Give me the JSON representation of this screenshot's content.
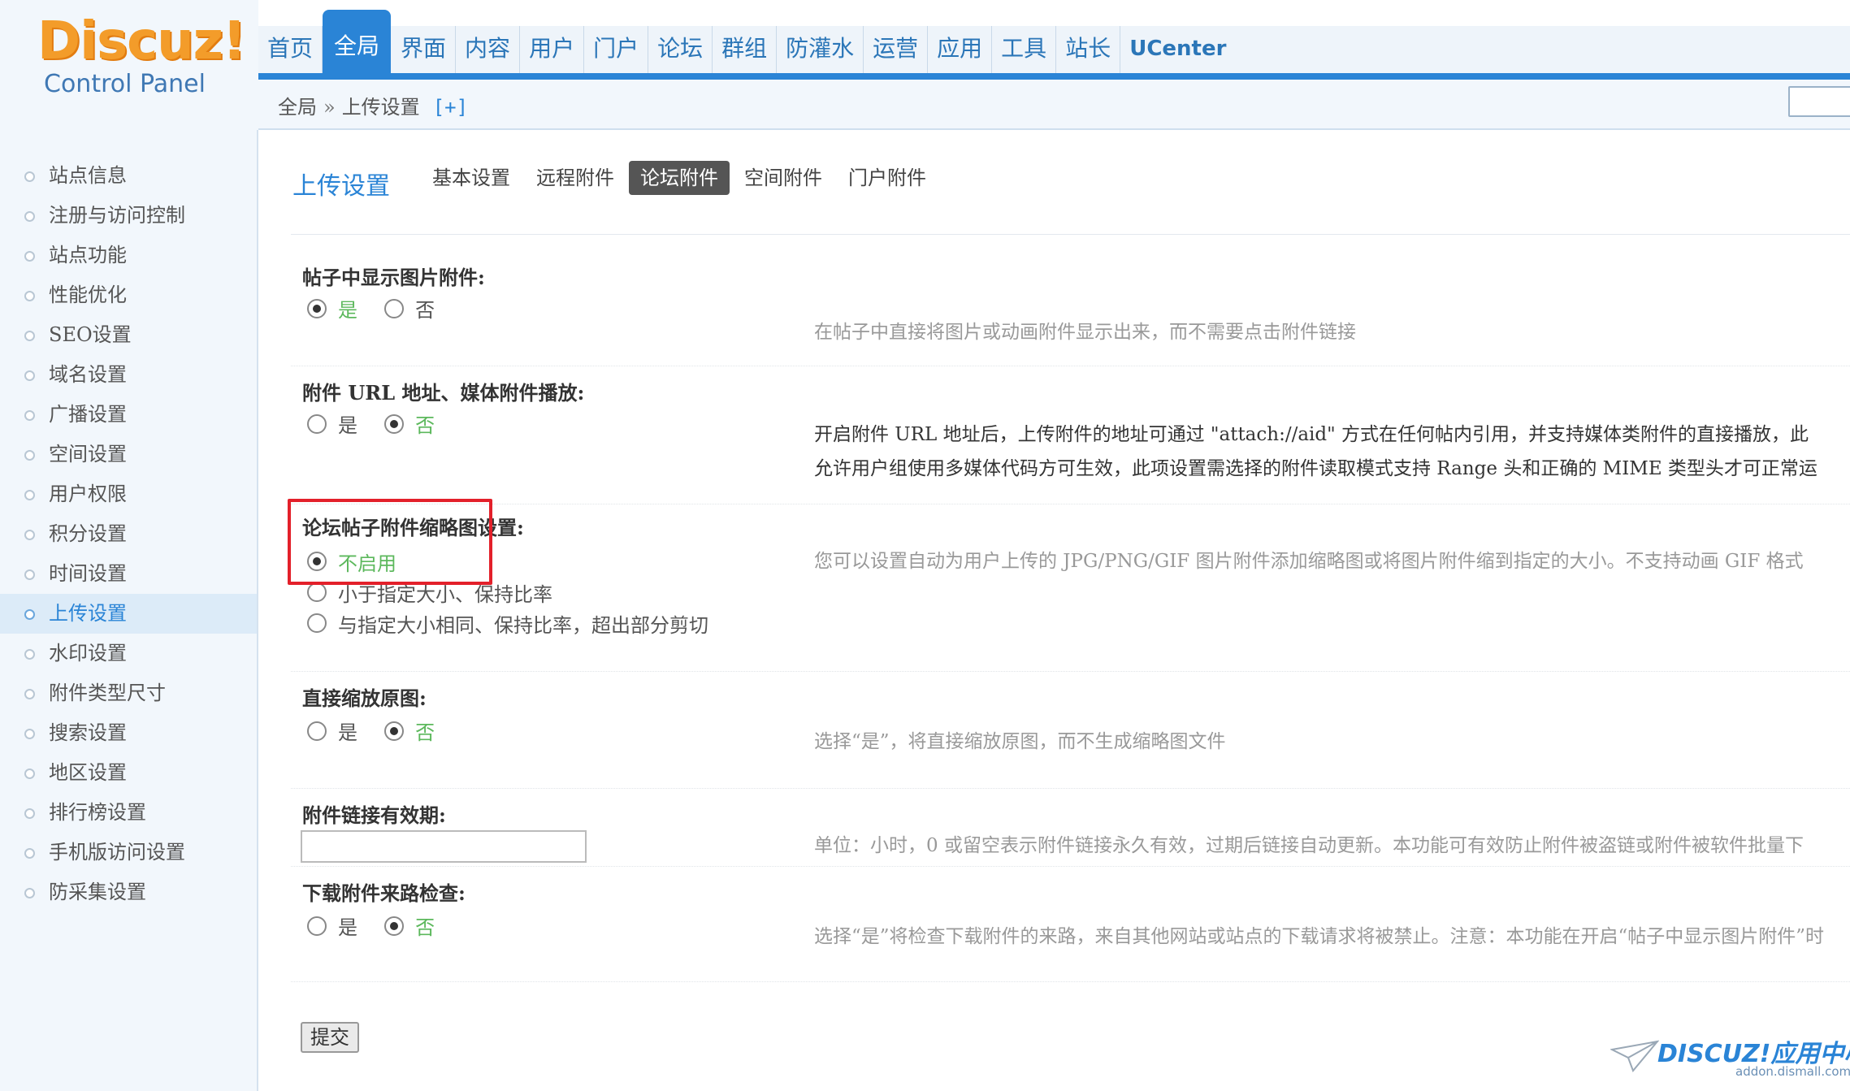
{
  "logo": {
    "main": "Discuz!",
    "sub": "Control Panel"
  },
  "topnav": [
    {
      "label": "首页"
    },
    {
      "label": "全局",
      "active": true
    },
    {
      "label": "界面"
    },
    {
      "label": "内容"
    },
    {
      "label": "用户"
    },
    {
      "label": "门户"
    },
    {
      "label": "论坛"
    },
    {
      "label": "群组"
    },
    {
      "label": "防灌水"
    },
    {
      "label": "运营"
    },
    {
      "label": "应用"
    },
    {
      "label": "工具"
    },
    {
      "label": "站长"
    },
    {
      "label": "UCenter"
    }
  ],
  "breadcrumb": {
    "root": "全局",
    "sep": "»",
    "current": "上传设置",
    "plus": "[+]"
  },
  "sidebar": {
    "items": [
      {
        "label": "站点信息"
      },
      {
        "label": "注册与访问控制"
      },
      {
        "label": "站点功能"
      },
      {
        "label": "性能优化"
      },
      {
        "label": "SEO设置"
      },
      {
        "label": "域名设置"
      },
      {
        "label": "广播设置"
      },
      {
        "label": "空间设置"
      },
      {
        "label": "用户权限"
      },
      {
        "label": "积分设置"
      },
      {
        "label": "时间设置"
      },
      {
        "label": "上传设置",
        "active": true
      },
      {
        "label": "水印设置"
      },
      {
        "label": "附件类型尺寸"
      },
      {
        "label": "搜索设置"
      },
      {
        "label": "地区设置"
      },
      {
        "label": "排行榜设置"
      },
      {
        "label": "手机版访问设置"
      },
      {
        "label": "防采集设置"
      }
    ]
  },
  "page": {
    "title": "上传设置",
    "tabs": [
      {
        "label": "基本设置"
      },
      {
        "label": "远程附件"
      },
      {
        "label": "论坛附件",
        "active": true
      },
      {
        "label": "空间附件"
      },
      {
        "label": "门户附件"
      }
    ]
  },
  "settings": {
    "show_images": {
      "label": "帖子中显示图片附件:",
      "options": [
        "是",
        "否"
      ],
      "selected": 0,
      "desc": "在帖子中直接将图片或动画附件显示出来，而不需要点击附件链接"
    },
    "attach_url": {
      "label": "附件 URL 地址、媒体附件播放:",
      "options": [
        "是",
        "否"
      ],
      "selected": 1,
      "desc1": "开启附件 URL 地址后，上传附件的地址可通过 \"attach://aid\" 方式在任何帖内引用，并支持媒体类附件的直接播放，此",
      "desc2": "允许用户组使用多媒体代码方可生效，此项设置需选择的附件读取模式支持 Range 头和正确的 MIME 类型头才可正常运"
    },
    "thumbnail": {
      "label": "论坛帖子附件缩略图设置:",
      "options": [
        "不启用",
        "小于指定大小、保持比率",
        "与指定大小相同、保持比率，超出部分剪切"
      ],
      "selected": 0,
      "desc": "您可以设置自动为用户上传的 JPG/PNG/GIF 图片附件添加缩略图或将图片附件缩到指定的大小。不支持动画 GIF 格式"
    },
    "direct_resize": {
      "label": "直接缩放原图:",
      "options": [
        "是",
        "否"
      ],
      "selected": 1,
      "desc": "选择“是”，将直接缩放原图，而不生成缩略图文件"
    },
    "link_expiry": {
      "label": "附件链接有效期:",
      "value": "",
      "desc": "单位：小时，0 或留空表示附件链接永久有效，过期后链接自动更新。本功能可有效防止附件被盗链或附件被软件批量下"
    },
    "referer_check": {
      "label": "下载附件来路检查:",
      "options": [
        "是",
        "否"
      ],
      "selected": 1,
      "desc": "选择“是”将检查下载附件的来路，来自其他网站或站点的下载请求将被禁止。注意：本功能在开启“帖子中显示图片附件”时"
    },
    "submit_label": "提交"
  },
  "watermark": {
    "main": "DISCUZ!应用中心",
    "sub": "addon.dismall.com"
  },
  "colors": {
    "accent": "#2a84d6",
    "logo": "#f39c2a",
    "selected_option": "#5cb85c",
    "highlight": "#e3202a"
  }
}
